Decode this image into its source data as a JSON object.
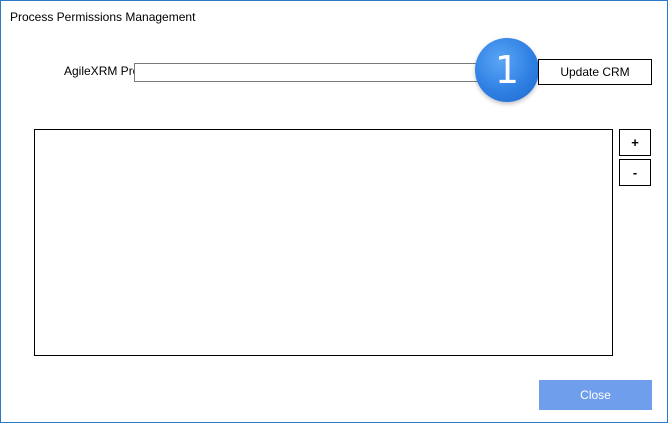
{
  "window": {
    "title": "Process Permissions Management"
  },
  "form": {
    "process_label": "AgileXRM Process",
    "process_value": "",
    "update_label": "Update CRM"
  },
  "badge": {
    "number": "1",
    "color": "#2f80e4"
  },
  "list": {
    "add_label": "+",
    "remove_label": "-",
    "items": []
  },
  "footer": {
    "close_label": "Close",
    "close_color": "#6f9fec"
  }
}
